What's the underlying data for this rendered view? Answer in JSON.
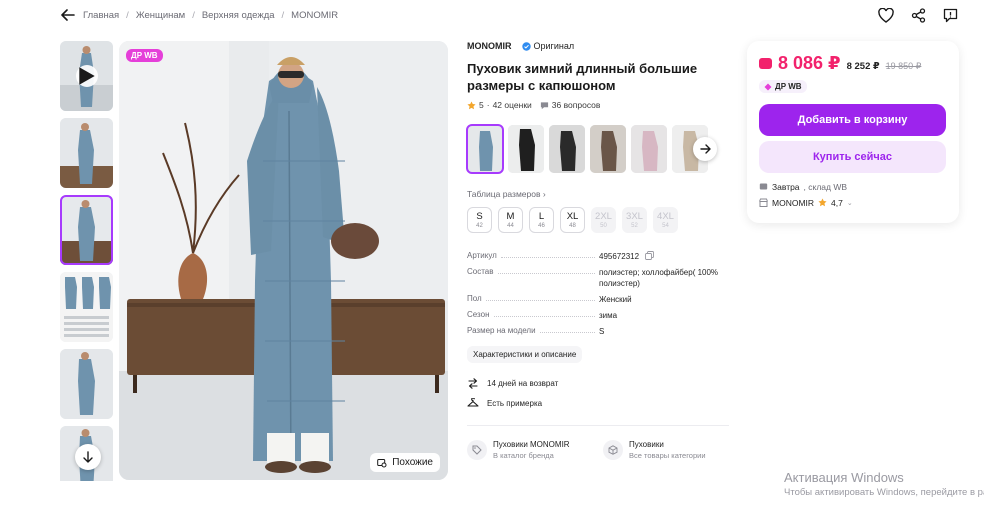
{
  "breadcrumb": {
    "items": [
      "Главная",
      "Женщинам",
      "Верхняя одежда",
      "MONOMIR"
    ]
  },
  "top_icons": [
    "heart-icon",
    "share-icon",
    "comment-icon"
  ],
  "main_image": {
    "badge": "ДР WB",
    "similar_label": "Похожие"
  },
  "product": {
    "brand": "MONOMIR",
    "original_label": "Оригинал",
    "title": "Пуховик зимний длинный большие размеры с капюшоном",
    "rating": "5",
    "reviews": "42 оценки",
    "questions": "36 вопросов",
    "size_table_label": "Таблица размеров",
    "sizes": [
      {
        "label": "S",
        "num": "42",
        "available": true
      },
      {
        "label": "M",
        "num": "44",
        "available": true
      },
      {
        "label": "L",
        "num": "46",
        "available": true
      },
      {
        "label": "XL",
        "num": "48",
        "available": true
      },
      {
        "label": "2XL",
        "num": "50",
        "available": false
      },
      {
        "label": "3XL",
        "num": "52",
        "available": false
      },
      {
        "label": "4XL",
        "num": "54",
        "available": false
      }
    ],
    "specs": [
      {
        "key": "Артикул",
        "value": "495672312"
      },
      {
        "key": "Состав",
        "value": "полиэстер; холлофайбер( 100% полиэстер)"
      },
      {
        "key": "Пол",
        "value": "Женский"
      },
      {
        "key": "Сезон",
        "value": "зима"
      },
      {
        "key": "Размер на модели",
        "value": "S"
      }
    ],
    "chars_button": "Характеристики и описание",
    "return_text": "14 дней на возврат",
    "fitting_text": "Есть примерка",
    "categories": [
      {
        "title": "Пуховики MONOMIR",
        "sub": "В каталог бренда"
      },
      {
        "title": "Пуховики",
        "sub": "Все товары категории"
      }
    ]
  },
  "buy_card": {
    "price": "8 086 ₽",
    "price_wallet": "8 252 ₽",
    "price_old": "19 850 ₽",
    "badge": "ДР WB",
    "cart_button": "Добавить в корзину",
    "buy_button": "Купить сейчас",
    "delivery_day": "Завтра",
    "delivery_rest": ", склад WB",
    "seller": "MONOMIR",
    "seller_rating": "4,7"
  },
  "watermark": {
    "line1": "Активация Windows",
    "line2": "Чтобы активировать Windows, перейдите в раздел"
  },
  "colors": {
    "accent": "#9d24ed",
    "price": "#f2226c",
    "coat": "#6f93ad"
  }
}
